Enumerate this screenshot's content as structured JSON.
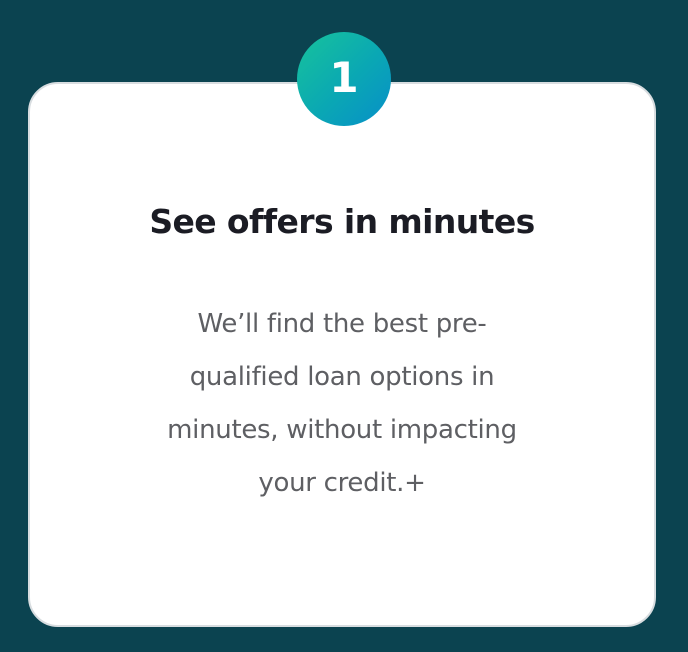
{
  "step": {
    "number": "1"
  },
  "card": {
    "title": "See offers in minutes",
    "description_lines": [
      "We’ll find the best pre-",
      "qualified loan options in",
      "minutes, without impacting",
      "your credit.+"
    ]
  },
  "colors": {
    "page_background": "#0b4350",
    "card_background": "#ffffff",
    "badge_gradient_start": "#17c39b",
    "badge_gradient_end": "#078fc9",
    "title_text": "#1b1c24",
    "body_text": "#5e5f63"
  }
}
